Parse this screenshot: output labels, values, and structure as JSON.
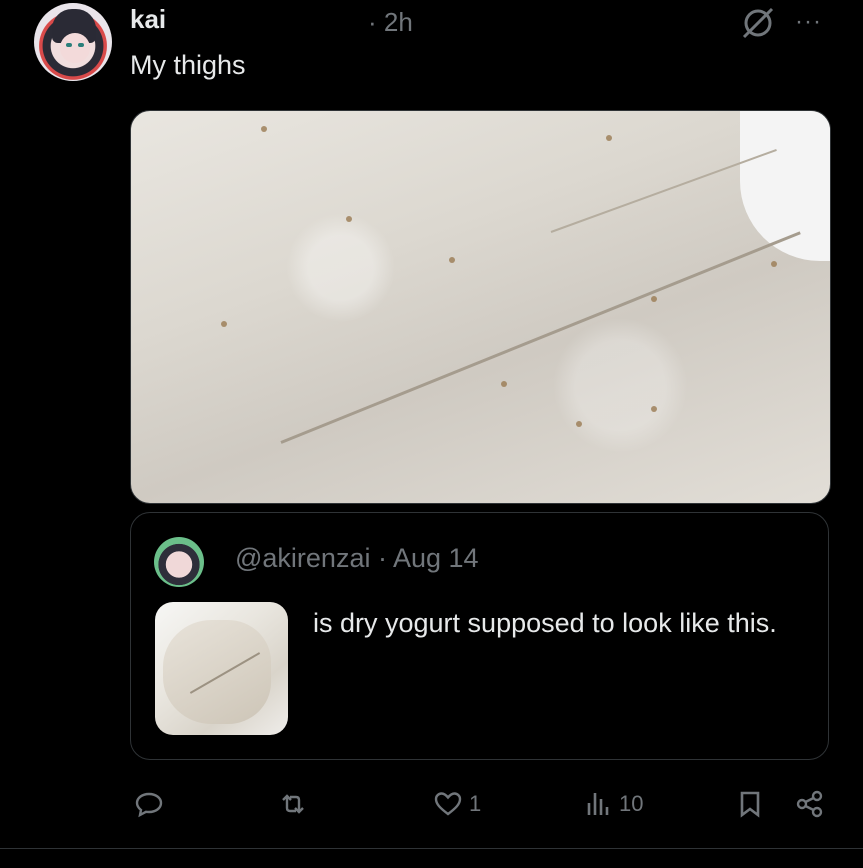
{
  "post": {
    "author_name": "kai",
    "time": "· 2h",
    "text": "My thighs",
    "more_label": "···"
  },
  "quote": {
    "handle_date": "@akirenzai · Aug 14",
    "text": "is dry yogurt supposed to look like this."
  },
  "actions": {
    "reply_count": "",
    "repost_count": "",
    "like_count": "1",
    "views_count": "10"
  },
  "icons": {
    "grok": "grok-icon",
    "more": "more-icon",
    "reply": "reply-icon",
    "repost": "repost-icon",
    "like": "heart-icon",
    "views": "views-icon",
    "bookmark": "bookmark-icon",
    "share": "share-icon"
  },
  "colors": {
    "background": "#000000",
    "text_primary": "#e7e9ea",
    "text_secondary": "#71767b",
    "border": "#2f3336"
  }
}
